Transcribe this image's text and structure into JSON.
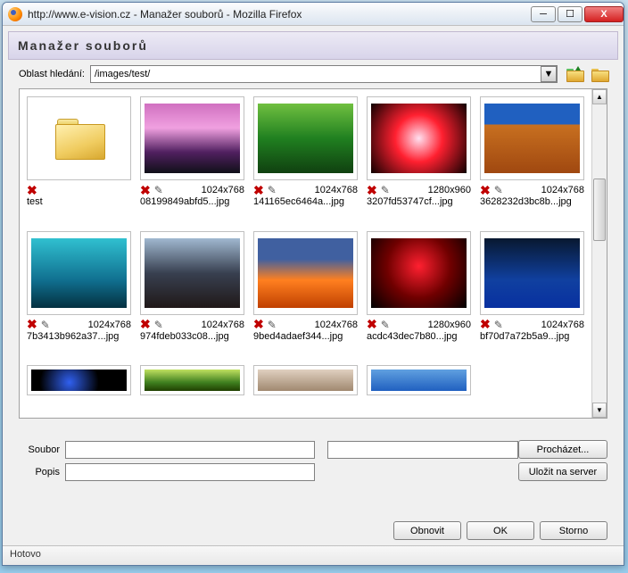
{
  "window": {
    "title": "http://www.e-vision.cz - Manažer souborů - Mozilla Firefox"
  },
  "header": {
    "title": "Manažer souborů"
  },
  "path": {
    "label": "Oblast hledání:",
    "value": "/images/test/"
  },
  "items": [
    {
      "type": "folder",
      "name": "test"
    },
    {
      "type": "image",
      "name": "08199849abfd5...jpg",
      "dims": "1024x768",
      "thumb": "g-sunset"
    },
    {
      "type": "image",
      "name": "141165ec6464a...jpg",
      "dims": "1024x768",
      "thumb": "g-forest"
    },
    {
      "type": "image",
      "name": "3207fd53747cf...jpg",
      "dims": "1280x960",
      "thumb": "g-red"
    },
    {
      "type": "image",
      "name": "3628232d3bc8b...jpg",
      "dims": "1024x768",
      "thumb": "g-arch"
    },
    {
      "type": "image",
      "name": "7b3413b962a37...jpg",
      "dims": "1024x768",
      "thumb": "g-teal"
    },
    {
      "type": "image",
      "name": "974fdeb033c08...jpg",
      "dims": "1024x768",
      "thumb": "g-lake"
    },
    {
      "type": "image",
      "name": "9bed4adaef344...jpg",
      "dims": "1024x768",
      "thumb": "g-fire"
    },
    {
      "type": "image",
      "name": "acdc43dec7b80...jpg",
      "dims": "1280x960",
      "thumb": "g-rose"
    },
    {
      "type": "image",
      "name": "bf70d7a72b5a9...jpg",
      "dims": "1024x768",
      "thumb": "g-moon"
    },
    {
      "type": "partial",
      "thumb": "g-dark"
    },
    {
      "type": "partial",
      "thumb": "g-green2"
    },
    {
      "type": "partial",
      "thumb": "g-pastel"
    },
    {
      "type": "partial",
      "thumb": "g-sky"
    }
  ],
  "form": {
    "file_label": "Soubor",
    "desc_label": "Popis",
    "browse_label": "Procházet...",
    "upload_label": "Uložit na server"
  },
  "buttons": {
    "refresh": "Obnovit",
    "ok": "OK",
    "cancel": "Storno"
  },
  "status": "Hotovo"
}
